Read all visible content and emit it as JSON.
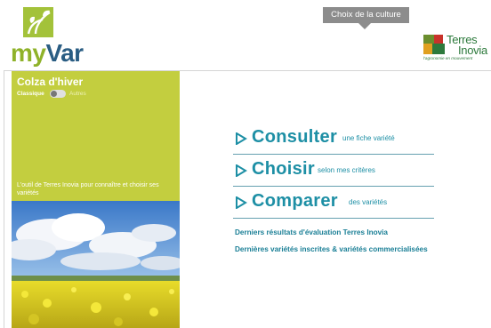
{
  "brand": {
    "logo_text_a": "my",
    "logo_text_b": "Var",
    "accent_green": "#8fb22a",
    "accent_blue": "#2a5d83"
  },
  "header": {
    "culture_button_label": "Choix de la culture"
  },
  "partner": {
    "name_line1": "Terres",
    "name_line2": "Inovia",
    "tagline": "l'agronomie en mouvement"
  },
  "panel": {
    "title": "Colza d'hiver",
    "toggle_on_label": "Classique",
    "toggle_off_label": "Autres",
    "description": "L'outil de Terres Inovia pour connaître et choisir ses variétés",
    "background_color": "#c3ce3f"
  },
  "menu": {
    "items": [
      {
        "big": "Consulter",
        "small": "une fiche variété"
      },
      {
        "big": "Choisir",
        "small": "selon mes critères"
      },
      {
        "big": "Comparer",
        "small": "des variétés"
      }
    ],
    "color": "#1d8fa5"
  },
  "links": {
    "results": "Derniers résultats d'évaluation Terres Inovia",
    "new_varieties": "Dernières variétés inscrites & variétés commercialisées"
  }
}
